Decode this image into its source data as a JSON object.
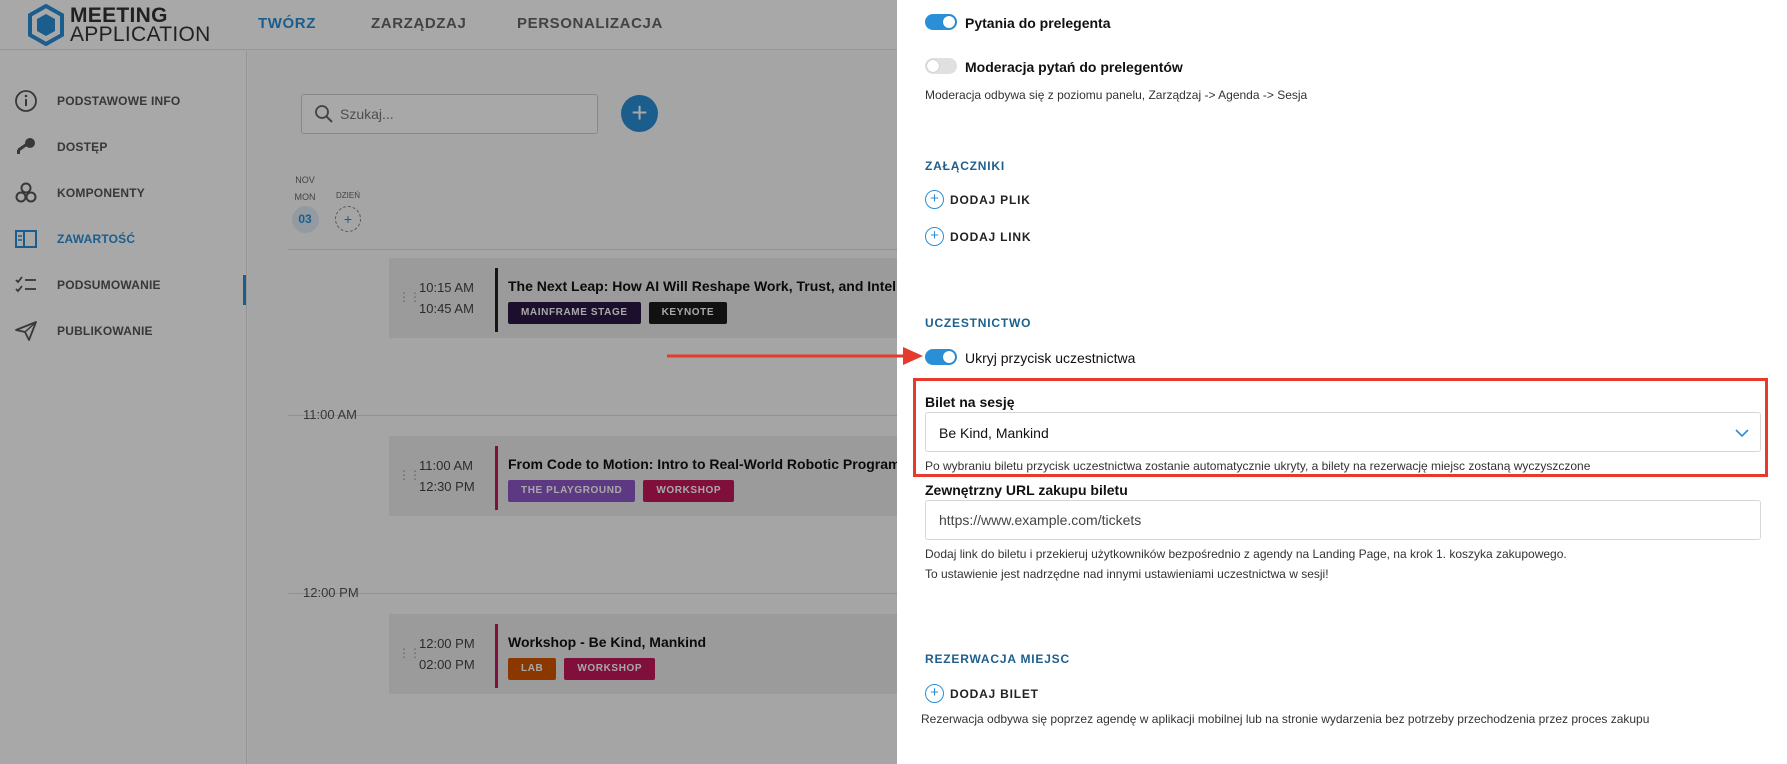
{
  "app": {
    "logo_line1": "MEETING",
    "logo_line2": "APPLICATION",
    "nav": [
      {
        "label": "TWÓRZ",
        "active": true
      },
      {
        "label": "ZARZĄDZAJ",
        "active": false
      },
      {
        "label": "PERSONALIZACJA",
        "active": false
      }
    ]
  },
  "sidebar": {
    "items": [
      {
        "label": "PODSTAWOWE INFO",
        "icon": "info-icon"
      },
      {
        "label": "DOSTĘP",
        "icon": "key-icon"
      },
      {
        "label": "KOMPONENTY",
        "icon": "components-icon"
      },
      {
        "label": "ZAWARTOŚĆ",
        "icon": "content-icon",
        "active": true
      },
      {
        "label": "PODSUMOWANIE",
        "icon": "checklist-icon"
      },
      {
        "label": "PUBLIKOWANIE",
        "icon": "send-icon"
      }
    ]
  },
  "agenda": {
    "search_placeholder": "Szukaj...",
    "add_label": "+",
    "date": {
      "month": "NOV",
      "weekday": "MON",
      "day": "03"
    },
    "day_label": "DZIEŃ",
    "day_add": "+",
    "time_labels": [
      "11:00 AM",
      "12:00 PM"
    ],
    "sessions": [
      {
        "start": "10:15 AM",
        "end": "10:45 AM",
        "title": "The Next Leap: How AI Will Reshape Work, Trust, and Intelligence",
        "bar_color": "#222222",
        "tags": [
          {
            "label": "MAINFRAME STAGE",
            "color": "#2b1845"
          },
          {
            "label": "KEYNOTE",
            "color": "#1a1a1a"
          }
        ]
      },
      {
        "start": "11:00 AM",
        "end": "12:30 PM",
        "title": "From Code to Motion: Intro to Real-World Robotic Programming",
        "bar_color": "#c2185b",
        "tags": [
          {
            "label": "THE PLAYGROUND",
            "color": "#8e57c9"
          },
          {
            "label": "WORKSHOP",
            "color": "#c2185b"
          }
        ]
      },
      {
        "start": "12:00 PM",
        "end": "02:00 PM",
        "title": "Workshop - Be Kind, Mankind",
        "bar_color": "#c2185b",
        "tags": [
          {
            "label": "LAB",
            "color": "#d35400"
          },
          {
            "label": "WORKSHOP",
            "color": "#c2185b"
          }
        ]
      }
    ]
  },
  "panel": {
    "questions_toggle_label": "Pytania do prelegenta",
    "questions_toggle_on": true,
    "moderation_toggle_label": "Moderacja pytań do prelegentów",
    "moderation_toggle_on": false,
    "moderation_note": "Moderacja odbywa się z poziomu panelu, Zarządzaj -> Agenda -> Sesja",
    "attachments_title": "ZAŁĄCZNIKI",
    "add_file_label": "DODAJ PLIK",
    "add_link_label": "DODAJ LINK",
    "participation_title": "UCZESTNICTWO",
    "hide_button_label": "Ukryj przycisk uczestnictwa",
    "hide_button_on": true,
    "ticket_label": "Bilet na sesję",
    "ticket_value": "Be Kind, Mankind",
    "ticket_note": "Po wybraniu biletu przycisk uczestnictwa zostanie automatycznie ukryty, a bilety na rezerwację miejsc zostaną wyczyszczone",
    "external_url_label": "Zewnętrzny URL zakupu biletu",
    "external_url_placeholder": "https://www.example.com/tickets",
    "external_url_note_1": "Dodaj link do biletu i przekieruj użytkowników bezpośrednio z agendy na Landing Page, na krok 1. koszyka zakupowego.",
    "external_url_note_2": "To ustawienie jest nadrzędne nad innymi ustawieniami uczestnictwa w sesji!",
    "reservation_title": "REZERWACJA MIEJSC",
    "add_ticket_label": "DODAJ BILET",
    "reservation_note": "Rezerwacja odbywa się poprzez agendę w aplikacji mobilnej lub na stronie wydarzenia bez potrzeby przechodzenia przez proces zakupu"
  },
  "colors": {
    "accent": "#2a8fd6",
    "section_title": "#1e5f8c",
    "highlight": "#e53a2c"
  }
}
